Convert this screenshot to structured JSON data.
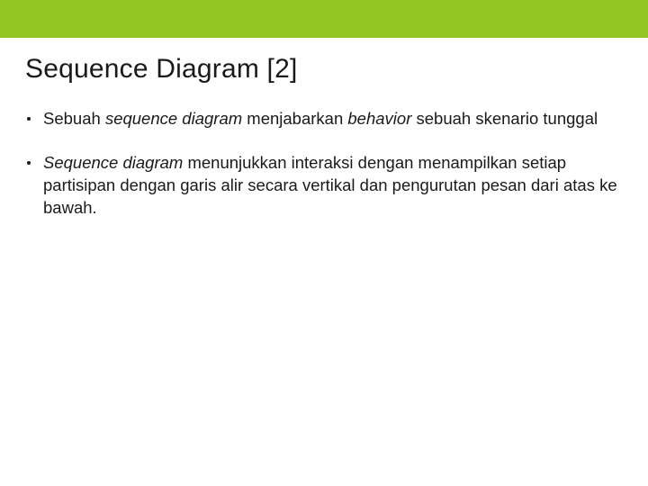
{
  "title": "Sequence Diagram [2]",
  "bullets": [
    {
      "parts": [
        {
          "text": "Sebuah ",
          "italic": false
        },
        {
          "text": "sequence diagram",
          "italic": true
        },
        {
          "text": " menjabarkan ",
          "italic": false
        },
        {
          "text": "behavior",
          "italic": true
        },
        {
          "text": " sebuah skenario tunggal",
          "italic": false
        }
      ]
    },
    {
      "parts": [
        {
          "text": "Sequence diagram",
          "italic": true
        },
        {
          "text": " menunjukkan interaksi dengan menampilkan setiap partisipan dengan garis alir secara vertikal dan pengurutan pesan dari atas ke bawah.",
          "italic": false
        }
      ]
    }
  ],
  "colors": {
    "accent": "#92c422"
  }
}
